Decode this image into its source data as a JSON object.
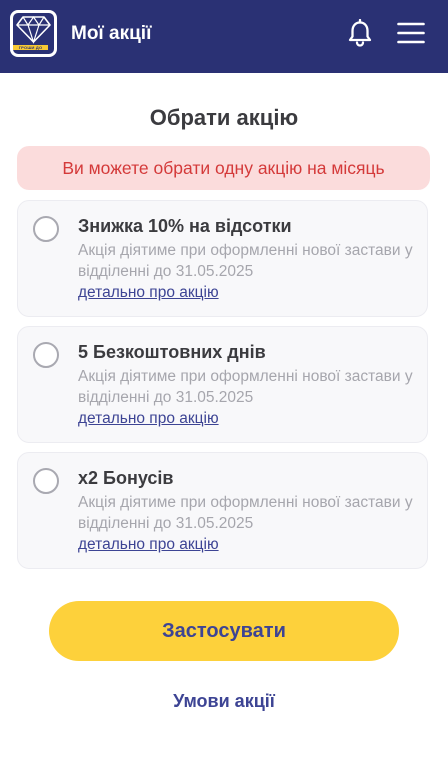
{
  "header": {
    "title": "Мої акції",
    "logo_strip_text": "ГРОШИ ДО ЗАРПЛАТИ",
    "logo_icon": "diamond-icon",
    "notification_icon": "bell-icon",
    "menu_icon": "hamburger-menu-icon",
    "background_color": "#2a3174"
  },
  "main": {
    "section_title": "Обрати акцію",
    "alert_text": "Ви можете обрати одну акцію на місяць",
    "promos": [
      {
        "title": "Знижка 10% на відсотки",
        "description": "Акція діятиме при оформленні нової застави у відділенні до 31.05.2025",
        "link": "детально про акцію",
        "selected": false
      },
      {
        "title": "5 Безкоштовних днів",
        "description": "Акція діятиме при оформленні нової застави у відділенні до 31.05.2025",
        "link": "детально про акцію",
        "selected": false
      },
      {
        "title": "х2 Бонусів",
        "description": "Акція діятиме при оформленні нової застави у відділенні до 31.05.2025",
        "link": "детально про акцію",
        "selected": false
      }
    ],
    "apply_button": "Застосувати",
    "terms_link": "Умови акції"
  },
  "colors": {
    "accent_yellow": "#fdd13b",
    "link_blue": "#3d4494",
    "alert_bg": "#fbdcdc",
    "alert_text": "#d43a3a"
  }
}
